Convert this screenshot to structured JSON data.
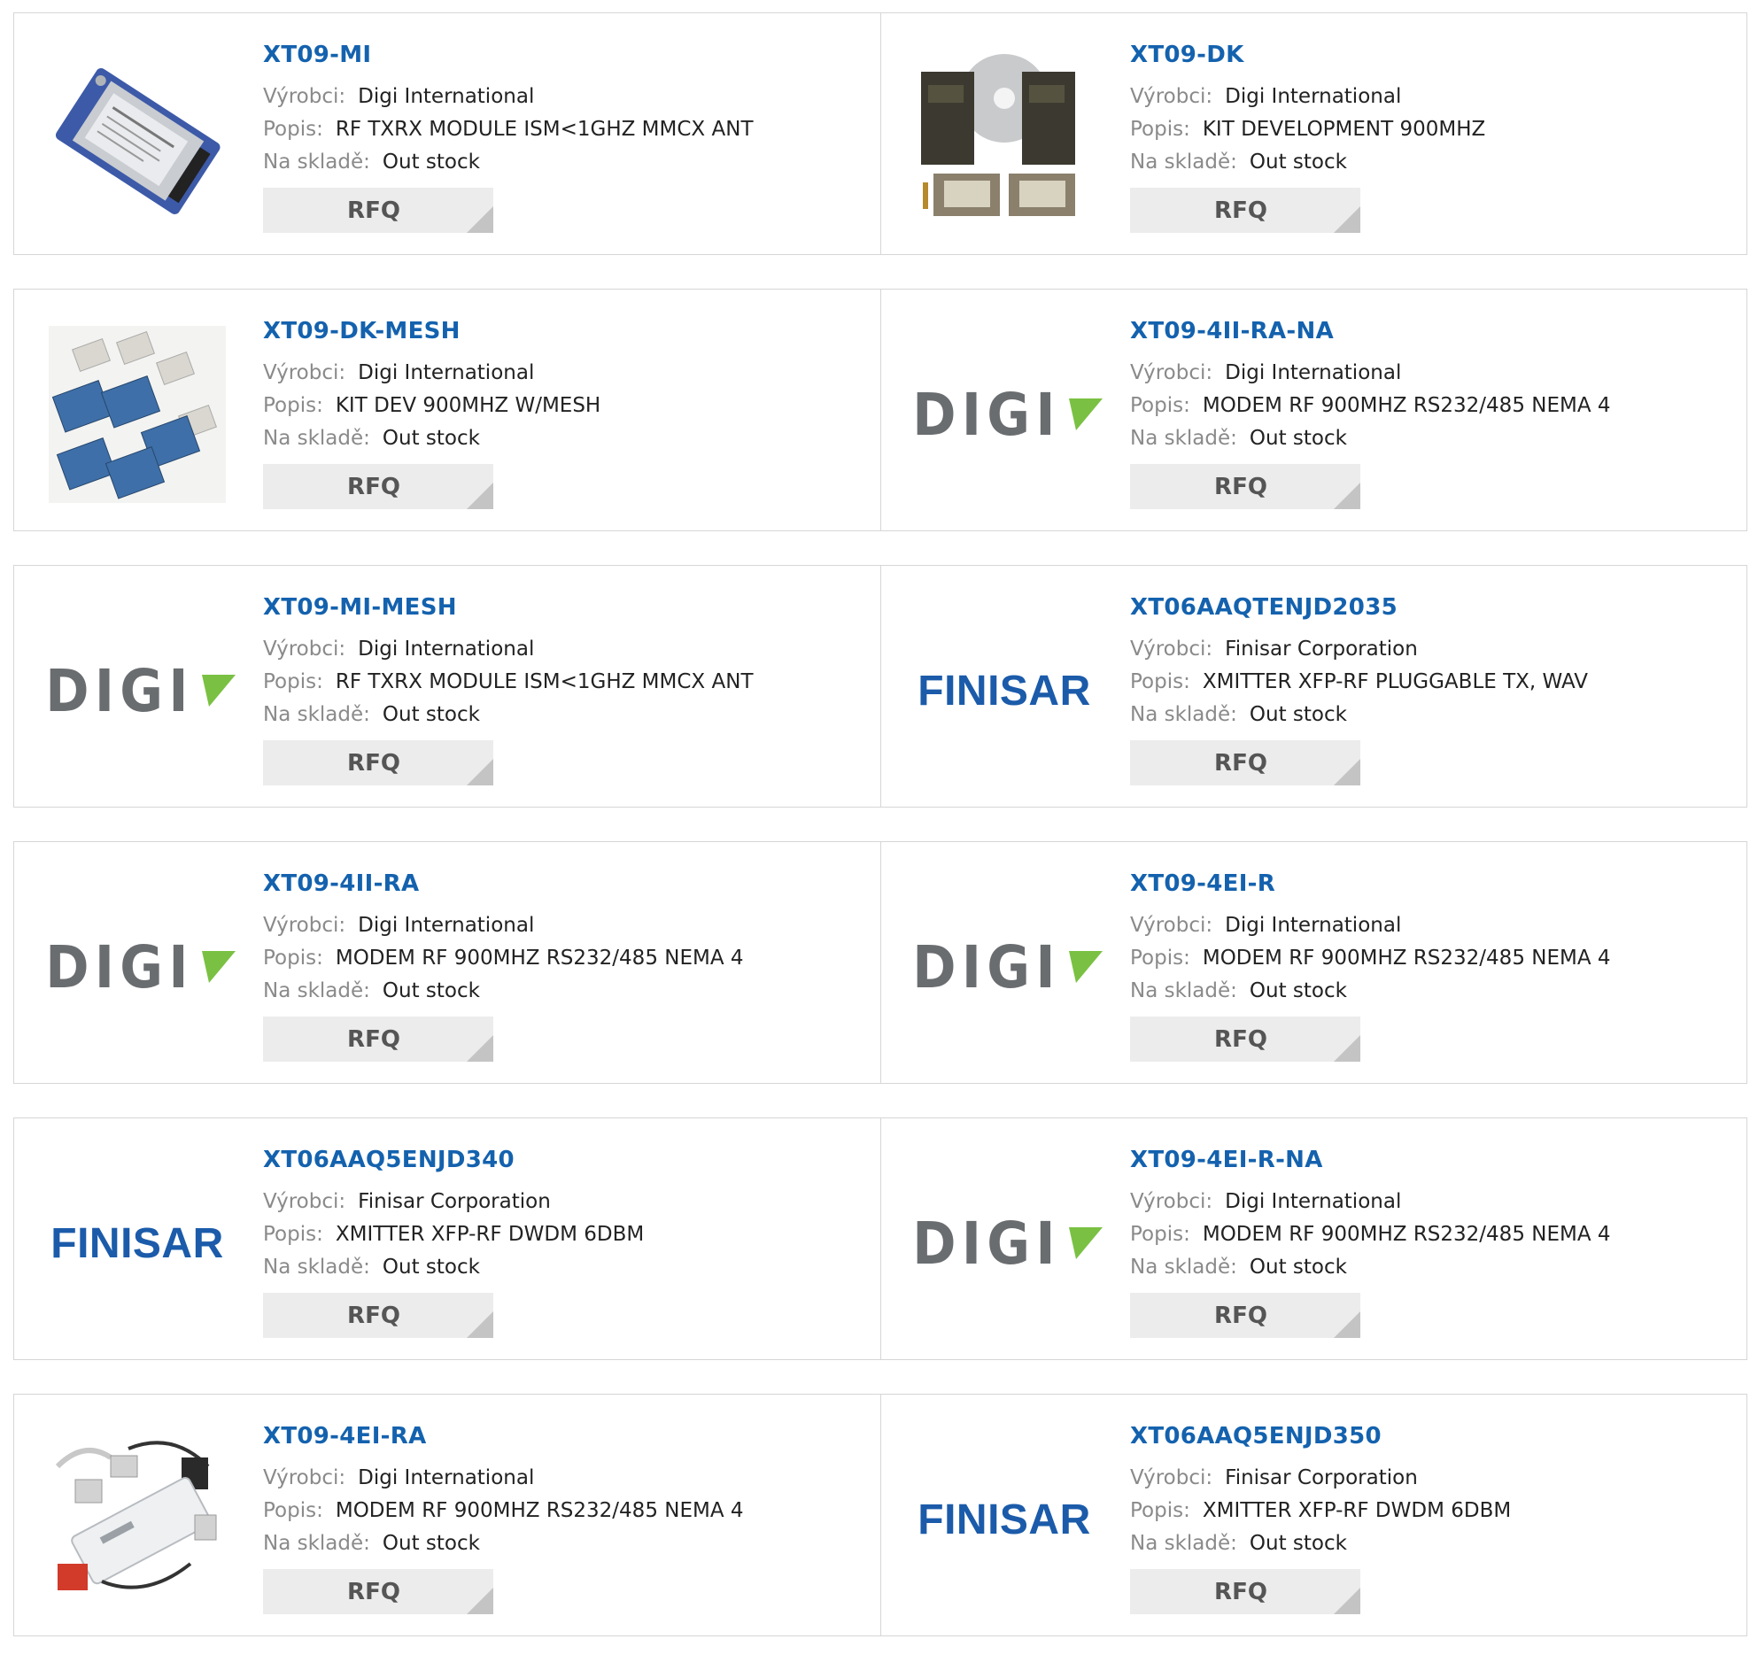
{
  "labels": {
    "manufacturer": "Výrobci:",
    "description": "Popis:",
    "stock": "Na skladě:",
    "rfq": "RFQ"
  },
  "brand_colors": {
    "link": "#1462ae",
    "digi_gray": "#6a6d70",
    "digi_green": "#7ac143",
    "finisar_blue": "#1b5baa"
  },
  "products": [
    {
      "part": "XT09-MI",
      "manufacturer": "Digi International",
      "description": "RF TXRX MODULE ISM<1GHZ MMCX ANT",
      "stock": "Out stock",
      "image": "rf-module-photo"
    },
    {
      "part": "XT09-DK",
      "manufacturer": "Digi International",
      "description": "KIT DEVELOPMENT 900MHZ",
      "stock": "Out stock",
      "image": "dev-kit-photo"
    },
    {
      "part": "XT09-DK-MESH",
      "manufacturer": "Digi International",
      "description": "KIT DEV 900MHZ W/MESH",
      "stock": "Out stock",
      "image": "mesh-kit-photo"
    },
    {
      "part": "XT09-4II-RA-NA",
      "manufacturer": "Digi International",
      "description": "MODEM RF 900MHZ RS232/485 NEMA 4",
      "stock": "Out stock",
      "image": "digi-logo",
      "logo_text": "DIGI"
    },
    {
      "part": "XT09-MI-MESH",
      "manufacturer": "Digi International",
      "description": "RF TXRX MODULE ISM<1GHZ MMCX ANT",
      "stock": "Out stock",
      "image": "digi-logo",
      "logo_text": "DIGI"
    },
    {
      "part": "XT06AAQTENJD2035",
      "manufacturer": "Finisar Corporation",
      "description": "XMITTER XFP-RF PLUGGABLE TX, WAV",
      "stock": "Out stock",
      "image": "finisar-logo",
      "logo_text": "FINISAR"
    },
    {
      "part": "XT09-4II-RA",
      "manufacturer": "Digi International",
      "description": "MODEM RF 900MHZ RS232/485 NEMA 4",
      "stock": "Out stock",
      "image": "digi-logo",
      "logo_text": "DIGI"
    },
    {
      "part": "XT09-4EI-R",
      "manufacturer": "Digi International",
      "description": "MODEM RF 900MHZ RS232/485 NEMA 4",
      "stock": "Out stock",
      "image": "digi-logo",
      "logo_text": "DIGI"
    },
    {
      "part": "XT06AAQ5ENJD340",
      "manufacturer": "Finisar Corporation",
      "description": "XMITTER XFP-RF DWDM 6DBM",
      "stock": "Out stock",
      "image": "finisar-logo",
      "logo_text": "FINISAR"
    },
    {
      "part": "XT09-4EI-R-NA",
      "manufacturer": "Digi International",
      "description": "MODEM RF 900MHZ RS232/485 NEMA 4",
      "stock": "Out stock",
      "image": "digi-logo",
      "logo_text": "DIGI"
    },
    {
      "part": "XT09-4EI-RA",
      "manufacturer": "Digi International",
      "description": "MODEM RF 900MHZ RS232/485 NEMA 4",
      "stock": "Out stock",
      "image": "modem-kit-photo"
    },
    {
      "part": "XT06AAQ5ENJD350",
      "manufacturer": "Finisar Corporation",
      "description": "XMITTER XFP-RF DWDM 6DBM",
      "stock": "Out stock",
      "image": "finisar-logo",
      "logo_text": "FINISAR"
    }
  ]
}
